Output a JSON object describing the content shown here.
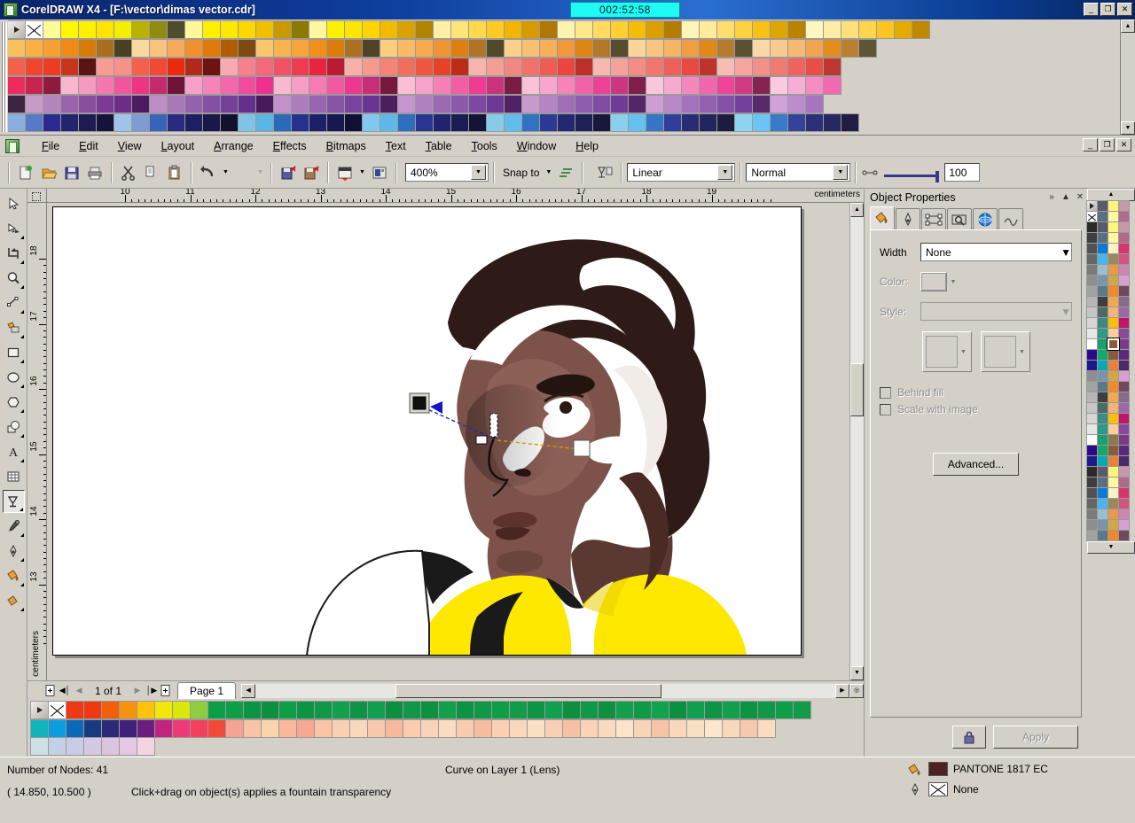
{
  "window": {
    "title": "CorelDRAW X4 - [F:\\vector\\dimas vector.cdr]",
    "timer": "002:52:58",
    "minimize": "_",
    "restore": "❐",
    "close": "✕"
  },
  "menu": {
    "items": [
      {
        "label": "File"
      },
      {
        "label": "Edit"
      },
      {
        "label": "View"
      },
      {
        "label": "Layout"
      },
      {
        "label": "Arrange"
      },
      {
        "label": "Effects"
      },
      {
        "label": "Bitmaps"
      },
      {
        "label": "Text"
      },
      {
        "label": "Table"
      },
      {
        "label": "Tools"
      },
      {
        "label": "Window"
      },
      {
        "label": "Help"
      }
    ],
    "mdi": {
      "minimize": "_",
      "restore": "❐",
      "close": "✕"
    }
  },
  "toolbar": {
    "zoom_level": "400%",
    "snap_to": "Snap to",
    "transparency_type": "Linear",
    "merge_mode": "Normal",
    "transparency_value": "100",
    "buttons": [
      {
        "name": "new-document-button"
      },
      {
        "name": "open-document-button"
      },
      {
        "name": "save-document-button"
      },
      {
        "name": "print-button"
      },
      {
        "name": "cut-button"
      },
      {
        "name": "copy-button"
      },
      {
        "name": "paste-button"
      },
      {
        "name": "undo-button"
      },
      {
        "name": "redo-button"
      },
      {
        "name": "import-button"
      },
      {
        "name": "export-button"
      },
      {
        "name": "application-launcher-button"
      },
      {
        "name": "corel-online-button"
      }
    ]
  },
  "toolbox": {
    "tools": [
      {
        "name": "pick-tool",
        "label": "Pick",
        "selected": false
      },
      {
        "name": "shape-tool",
        "label": "Shape",
        "selected": false
      },
      {
        "name": "crop-tool",
        "label": "Crop",
        "selected": false
      },
      {
        "name": "zoom-tool",
        "label": "Zoom",
        "selected": false
      },
      {
        "name": "freehand-tool",
        "label": "Freehand",
        "selected": false
      },
      {
        "name": "smart-fill-tool",
        "label": "Smart Fill",
        "selected": false
      },
      {
        "name": "rectangle-tool",
        "label": "Rectangle",
        "selected": false
      },
      {
        "name": "ellipse-tool",
        "label": "Ellipse",
        "selected": false
      },
      {
        "name": "polygon-tool",
        "label": "Polygon",
        "selected": false
      },
      {
        "name": "basic-shapes-tool",
        "label": "Basic Shapes",
        "selected": false
      },
      {
        "name": "text-tool",
        "label": "Text",
        "selected": false
      },
      {
        "name": "table-tool",
        "label": "Table",
        "selected": false
      },
      {
        "name": "transparency-tool",
        "label": "Interactive Transparency",
        "selected": true
      },
      {
        "name": "eyedropper-tool",
        "label": "Eyedropper",
        "selected": false
      },
      {
        "name": "outline-pen-tool",
        "label": "Outline Pen",
        "selected": false
      },
      {
        "name": "fill-tool",
        "label": "Fill",
        "selected": false
      },
      {
        "name": "interactive-fill-tool",
        "label": "Interactive Fill",
        "selected": false
      }
    ]
  },
  "rulers": {
    "unit": "centimeters",
    "horizontal_labels": [
      "10",
      "11",
      "12",
      "13",
      "14",
      "15",
      "16",
      "17",
      "18",
      "19"
    ],
    "vertical_labels": [
      "18",
      "17",
      "16",
      "15",
      "14",
      "13"
    ]
  },
  "pagenav": {
    "count": "1 of 1",
    "tab": "Page 1",
    "first": "◀│",
    "prev": "◀",
    "next": "▶",
    "last": "│▶"
  },
  "docker": {
    "title": "Object Properties",
    "collapse": "»",
    "rollup": "▲",
    "close": "✕",
    "tabs": [
      {
        "name": "fill-tab",
        "label": "Fill",
        "active": true
      },
      {
        "name": "outline-tab",
        "label": "Outline",
        "active": false
      },
      {
        "name": "rectangle-tab",
        "label": "Rectangle",
        "active": false
      },
      {
        "name": "general-tab",
        "label": "General",
        "active": false
      },
      {
        "name": "internet-tab",
        "label": "Internet",
        "active": false
      },
      {
        "name": "curve-tab",
        "label": "Curve",
        "active": false
      }
    ],
    "width_label": "Width",
    "width_value": "None",
    "color_label": "Color:",
    "style_label": "Style:",
    "behind_fill_label": "Behind fill",
    "scale_with_image_label": "Scale with image",
    "advanced_label": "Advanced...",
    "apply_label": "Apply",
    "lock_label": "Lock"
  },
  "statusbar": {
    "nodes": "Number of Nodes: 41",
    "object_info": "Curve on Layer 1  (Lens)",
    "coordinates": "( 14.850, 10.500 )",
    "hint": "Click+drag on object(s) applies a fountain transparency",
    "fill_color_name": "PANTONE 1817 EC",
    "fill_color_hex": "#4d2222",
    "outline_name": "None"
  },
  "palettes": {
    "top_rows": [
      [
        "#fffa9a",
        "#fff700",
        "#fff000",
        "#ffe400",
        "#f5ee00",
        "#b9b200",
        "#8f8a10",
        "#4e4c2a",
        "#fff79a",
        "#fff000",
        "#fde800",
        "#fbd800",
        "#f0c000",
        "#c89a00",
        "#8a7a00",
        "#fff8a0",
        "#fff100",
        "#ffe600",
        "#ffd400",
        "#f3bb00",
        "#d8a300",
        "#b08400",
        "#fff0a8",
        "#ffe47a",
        "#ffd84e",
        "#ffcb22",
        "#f2b600",
        "#d79a00",
        "#b07800",
        "#fff3b0",
        "#ffe78c",
        "#ffdb60",
        "#ffcf34",
        "#f6bc08",
        "#dba000",
        "#b57d00",
        "#fff5b8",
        "#ffeb99",
        "#ffde6d",
        "#ffd240",
        "#f9c114",
        "#e0a600",
        "#bb8200",
        "#fff7c0",
        "#ffeda5",
        "#ffe17a",
        "#ffd54d",
        "#fcc521",
        "#e4ab00",
        "#c08700"
      ],
      [
        "#fbc05a",
        "#f9b143",
        "#f7a132",
        "#f08a12",
        "#d87b08",
        "#a96f1e",
        "#4a4122",
        "#fad9a0",
        "#f9c27e",
        "#f8a95c",
        "#f1912e",
        "#e07a0a",
        "#b05c00",
        "#7c4a10",
        "#fbc569",
        "#f9b54d",
        "#f7a43a",
        "#f08f1a",
        "#da7d0c",
        "#ad7020",
        "#4e4526",
        "#fbcd7d",
        "#f9bb66",
        "#f7aa4e",
        "#f09533",
        "#dc8110",
        "#b07425",
        "#52482a",
        "#fbd08a",
        "#f9c073",
        "#f7af5a",
        "#f09a3c",
        "#de8514",
        "#b37829",
        "#564c2e",
        "#fbd497",
        "#f9c580",
        "#f7b566",
        "#f09f45",
        "#e08918",
        "#b67c2d",
        "#5a5032",
        "#fbd8a4",
        "#f9ca8d",
        "#f7ba72",
        "#f0a44e",
        "#e28d1c",
        "#b98031",
        "#5e5436"
      ],
      [
        "#f4604a",
        "#f0462e",
        "#ec3c22",
        "#c9341c",
        "#5c1410",
        "#f99b95",
        "#f7918a",
        "#f4604a",
        "#f04a34",
        "#ec2a0c",
        "#b02a1a",
        "#6e1410",
        "#f9a9b0",
        "#f6808c",
        "#f4697a",
        "#f15266",
        "#ee3b52",
        "#e8243e",
        "#bc1a30",
        "#f9b0a8",
        "#f79a8e",
        "#f48474",
        "#f16e5a",
        "#ee5840",
        "#e84226",
        "#bc2c18",
        "#f7b4ac",
        "#f59e96",
        "#f38880",
        "#f1726a",
        "#ef5c54",
        "#e8463e",
        "#bc3028",
        "#f7b8b0",
        "#f5a29a",
        "#f38c84",
        "#f1766e",
        "#ef6058",
        "#e84a42",
        "#bc342c",
        "#f7bcb4",
        "#f5a69e",
        "#f39088",
        "#f17a72",
        "#ef645c",
        "#e84e46",
        "#bc3830"
      ],
      [
        "#ee2a5e",
        "#c82450",
        "#8e1a3e",
        "#f9b6cc",
        "#f79ac0",
        "#f478ae",
        "#f1569c",
        "#ee3484",
        "#c62a6e",
        "#6e1438",
        "#f7a0c8",
        "#f584ba",
        "#f368ac",
        "#f14c9e",
        "#ee3090",
        "#f9bad0",
        "#f79ec4",
        "#f47cb2",
        "#f15aa0",
        "#ee388e",
        "#c82e78",
        "#74183e",
        "#f9bed4",
        "#f7a2c8",
        "#f480b6",
        "#f15ea4",
        "#ee3c92",
        "#ca327c",
        "#7a1c44",
        "#f9c2d8",
        "#f7a6cc",
        "#f484ba",
        "#f162a8",
        "#ee4096",
        "#cc3680",
        "#80204a",
        "#f9c6dc",
        "#f7aad0",
        "#f488be",
        "#f166ac",
        "#ee449a",
        "#ce3a84",
        "#862450",
        "#f9cae0",
        "#f7aed4",
        "#f48cc2",
        "#f16ab0"
      ],
      [
        "#3e2440",
        "#c89ac8",
        "#b484bc",
        "#9a64ac",
        "#8a4ea0",
        "#7c3a96",
        "#6e2e88",
        "#4c1a60",
        "#bc8ec4",
        "#a878b8",
        "#9462ac",
        "#8450a2",
        "#74409a",
        "#64308c",
        "#481a5c",
        "#c092c8",
        "#ac7cbc",
        "#9866b0",
        "#8854a6",
        "#78449e",
        "#683490",
        "#4c1e60",
        "#c496cc",
        "#b080c0",
        "#9c6ab4",
        "#8c58aa",
        "#7c48a2",
        "#6c3894",
        "#502264",
        "#c89ad0",
        "#b484c4",
        "#a06eb8",
        "#905cae",
        "#804ca6",
        "#703c98",
        "#542668",
        "#cc9ed4",
        "#b888c8",
        "#a472bc",
        "#9460b2",
        "#8450aa",
        "#74409c",
        "#582a6c",
        "#d0a2d8",
        "#bc8ccc",
        "#a876c0"
      ],
      [
        "#8aaee0",
        "#5878c8",
        "#2a2a90",
        "#24246e",
        "#1c1c52",
        "#14143a",
        "#9ec4ea",
        "#7e9cd4",
        "#3a64b8",
        "#2a2a80",
        "#1e1e62",
        "#18184a",
        "#121230",
        "#7ec4ea",
        "#5ab4e4",
        "#2a6aba",
        "#24328e",
        "#1c2068",
        "#161850",
        "#101034",
        "#82c8ee",
        "#5eb8e8",
        "#2e6ebe",
        "#283692",
        "#20246c",
        "#1a1c54",
        "#141438",
        "#86cce8",
        "#62bcec",
        "#3272c2",
        "#2c3a96",
        "#242870",
        "#1e2058",
        "#18183c",
        "#8ad0ec",
        "#66c0f0",
        "#3676c6",
        "#303e9a",
        "#282c74",
        "#22245c",
        "#1c1c40",
        "#8ed4f0",
        "#6ac4f4",
        "#3a7aca",
        "#344298",
        "#2c3078",
        "#262860",
        "#201c44"
      ]
    ],
    "bottom_rows": [
      [
        "#ee3a12",
        "#ee3a12",
        "#f25e0a",
        "#f5920e",
        "#fbc40a",
        "#f2e70a",
        "#d9e80a",
        "#8ece3e",
        "#0e9e48",
        "#0e9e48",
        "#0c9444",
        "#0c9040",
        "#0e9e48",
        "#0c9444",
        "#109848",
        "#12a04c",
        "#0e9444",
        "#10a050",
        "#0c9040",
        "#109848",
        "#0e9040",
        "#12a04c",
        "#0c9444",
        "#109848",
        "#0e9e48",
        "#129c4a",
        "#0e9444",
        "#10a050",
        "#0c9040",
        "#109848",
        "#0e9040",
        "#12a04c",
        "#0e9a46",
        "#10a24e",
        "#0c9040",
        "#10a050",
        "#0e9444",
        "#12a04c",
        "#0c9444",
        "#109848",
        "#0e9e48",
        "#129c4a"
      ],
      [
        "#10b4bc",
        "#0a9ede",
        "#0a6ab8",
        "#1a3a80",
        "#2a2a78",
        "#40207a",
        "#6a1e7e",
        "#c0247e",
        "#ee3a78",
        "#f2405e",
        "#f24a3a",
        "#f5a494",
        "#f9c4a4",
        "#fbd4ae",
        "#f9b89a",
        "#f7a890",
        "#fbc4a6",
        "#f9d0b4",
        "#fbd8bc",
        "#f9c8ac",
        "#f7b89c",
        "#fbccb0",
        "#f9d4b8",
        "#fbdcc0",
        "#f9ccb0",
        "#f7bca0",
        "#fbd0b4",
        "#f9d8bc",
        "#fbe0c4",
        "#f9d0b4",
        "#f7c0a4",
        "#fbd4b8",
        "#f9dcc0",
        "#fbe4c8",
        "#f9d4b8",
        "#f7c4a8",
        "#fbd8bc",
        "#f9e0c4",
        "#fbe8cc",
        "#f9d8bc",
        "#f7c8ac",
        "#fbdcc0"
      ],
      [
        "#cfe0e4",
        "#c4d0e8",
        "#c8cce8",
        "#d4c8e4",
        "#dcc4e0",
        "#e4c8e4",
        "#f4d4e0"
      ]
    ],
    "right_columns": [
      [
        "#2a2a2a",
        "#3e3e3e",
        "#525252",
        "#666666",
        "#7a7a7a",
        "#8e8e8e",
        "#a2a2a2",
        "#b6b6b6",
        "#c6c6c6",
        "#d6d6d6",
        "#e6e6e6",
        "#ffffff",
        "#2a0a8a",
        "#1a1a8a"
      ],
      [
        "#5a5a6e",
        "#5a7080",
        "#0a7ad4",
        "#4ab4ee",
        "#9ac0d0",
        "#7a94a8",
        "#5a7a8a",
        "#3e3e3e",
        "#4a6a68",
        "#3e8a82",
        "#2e9a8a",
        "#1aa070",
        "#12a868",
        "#0aa8b4"
      ],
      [
        "#fff67a",
        "#fff8a0",
        "#fbf4c0",
        "#9a8a5a",
        "#e89a4a",
        "#d0a84a",
        "#f2882a",
        "#f2a850",
        "#f2b478",
        "#fbbe0a",
        "#fbcf9a",
        "#8a7a4a",
        "#8a5a3a",
        "#e8823a"
      ],
      [
        "#c49aa8",
        "#b06a8a",
        "#d8346e",
        "#d0547e",
        "#c888b0",
        "#d8a0d0",
        "#6e4a5a",
        "#8a6a8a",
        "#9a6aa8",
        "#c0146a",
        "#8a4a9a",
        "#7a3a8a",
        "#5a2a7a",
        "#4a2a6a"
      ]
    ],
    "selected_right": {
      "col": 2,
      "row": 11,
      "color": "#8a5a3a"
    }
  }
}
